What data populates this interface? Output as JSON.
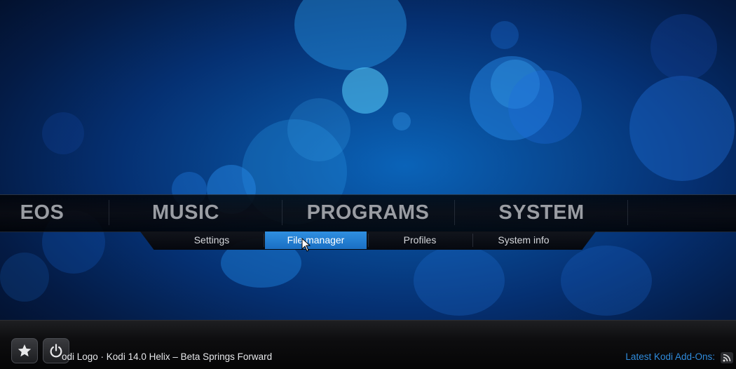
{
  "main_menu": {
    "items": [
      {
        "label": "EOS"
      },
      {
        "label": "MUSIC"
      },
      {
        "label": "PROGRAMS"
      },
      {
        "label": "SYSTEM"
      }
    ]
  },
  "sub_menu": {
    "items": [
      {
        "label": "Settings"
      },
      {
        "label": "File manager",
        "selected": true
      },
      {
        "label": "Profiles"
      },
      {
        "label": "System info"
      }
    ]
  },
  "footer": {
    "favourites_icon": "star-icon",
    "power_icon": "power-icon",
    "rss_ticker": "odi Logo · Kodi 14.0 Helix – Beta Springs Forward",
    "addons_label": "Latest Kodi Add-Ons:",
    "rss_icon": "rss-icon"
  },
  "colors": {
    "accent": "#1a6fc4",
    "menu_text": "#9a9da3",
    "link": "#2f8bdc"
  }
}
